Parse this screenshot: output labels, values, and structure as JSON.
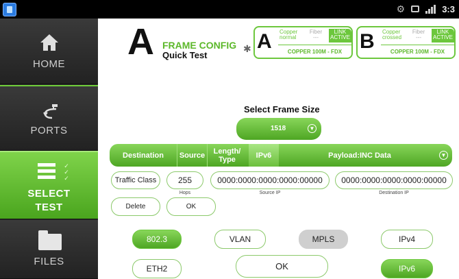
{
  "status_bar": {
    "time": "3:3",
    "icons": [
      "app-icon",
      "gear-icon",
      "sd-card-icon",
      "signal-icon"
    ]
  },
  "sidebar": {
    "items": [
      {
        "label": "HOME",
        "icon": "home-icon"
      },
      {
        "label": "PORTS",
        "icon": "ports-icon"
      },
      {
        "label": "SELECT\nTEST",
        "label_line1": "SELECT",
        "label_line2": "TEST",
        "icon": "select-test-icon",
        "active": true
      },
      {
        "label": "FILES",
        "icon": "folder-icon"
      }
    ]
  },
  "header": {
    "letter": "A",
    "title": "FRAME CONFIG",
    "subtitle": "Quick Test",
    "bluetooth_icon": "bluetooth-icon"
  },
  "ports": {
    "a": {
      "letter": "A",
      "copper_l1": "Copper",
      "copper_l2": "normal",
      "fiber_l1": "Fiber",
      "fiber_l2": "---",
      "link_l1": "LINK",
      "link_l2": "ACTIVE",
      "status": "COPPER 100M - FDX"
    },
    "b": {
      "letter": "B",
      "copper_l1": "Copper",
      "copper_l2": "crossed",
      "fiber_l1": "Fiber",
      "fiber_l2": "---",
      "link_l1": "LINK",
      "link_l2": "ACTIVE",
      "status": "COPPER 100M - FDX"
    }
  },
  "frame_size": {
    "label": "Select Frame Size",
    "value": "1518"
  },
  "tabs": {
    "destination": "Destination",
    "source": "Source",
    "length_l1": "Length/",
    "length_l2": "Type",
    "ipv6": "IPv6",
    "payload": "Payload:INC Data",
    "active": "ipv6"
  },
  "fields": {
    "traffic_class": "Traffic Class",
    "hops_value": "255",
    "hops_caption": "Hops",
    "source_ip": "0000:0000:0000:0000:00000",
    "source_ip_caption": "Source IP",
    "destination_ip": "0000:0000:0000:0000:00000",
    "destination_ip_caption": "Destination IP",
    "delete": "Delete",
    "ok_small": "OK"
  },
  "protocols": {
    "p8023": "802.3",
    "vlan": "VLAN",
    "mpls": "MPLS",
    "ipv4": "IPv4",
    "eth2": "ETH2",
    "ipv6": "IPv6",
    "selected": [
      "802.3",
      "IPv6"
    ],
    "disabled": [
      "MPLS"
    ]
  },
  "ok_button": "OK",
  "colors": {
    "accent_green": "#6cc73c",
    "sidebar_bg": "#2b2b2b",
    "status_bar_bg": "#000000"
  }
}
